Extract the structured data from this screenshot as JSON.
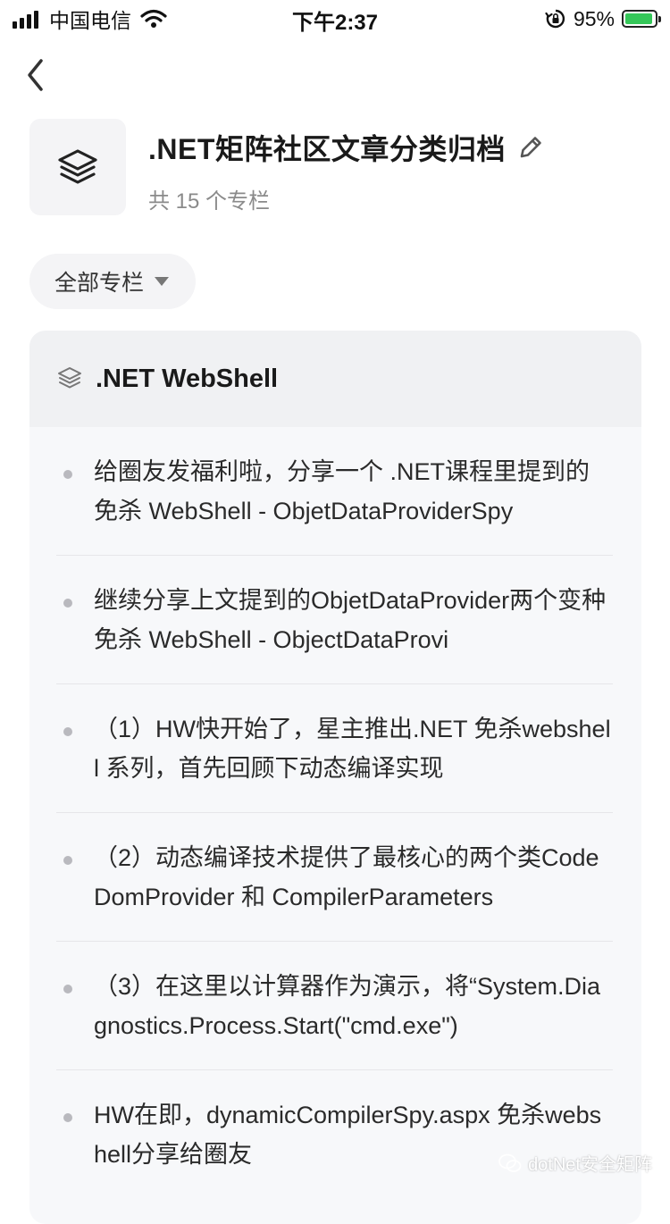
{
  "status_bar": {
    "carrier": "中国电信",
    "time": "下午2:37",
    "battery": "95%",
    "battery_level": 0.95
  },
  "header": {
    "title": ".NET矩阵社区文章分类归档",
    "subtitle": "共 15 个专栏"
  },
  "filter": {
    "label": "全部专栏"
  },
  "column": {
    "title": ".NET WebShell",
    "articles": [
      "给圈友发福利啦，分享一个 .NET课程里提到的免杀 WebShell - ObjetDataProviderSpy",
      "继续分享上文提到的ObjetDataProvider两个变种免杀 WebShell - ObjectDataProvi",
      "（1）HW快开始了，星主推出.NET 免杀webshell 系列，首先回顾下动态编译实现",
      "（2）动态编译技术提供了最核心的两个类CodeDomProvider 和 CompilerParameters",
      "（3）在这里以计算器作为演示，将“System.Diagnostics.Process.Start(\"cmd.exe\")",
      "HW在即，dynamicCompilerSpy.aspx 免杀webshell分享给圈友"
    ]
  },
  "watermark": "dotNet安全矩阵"
}
